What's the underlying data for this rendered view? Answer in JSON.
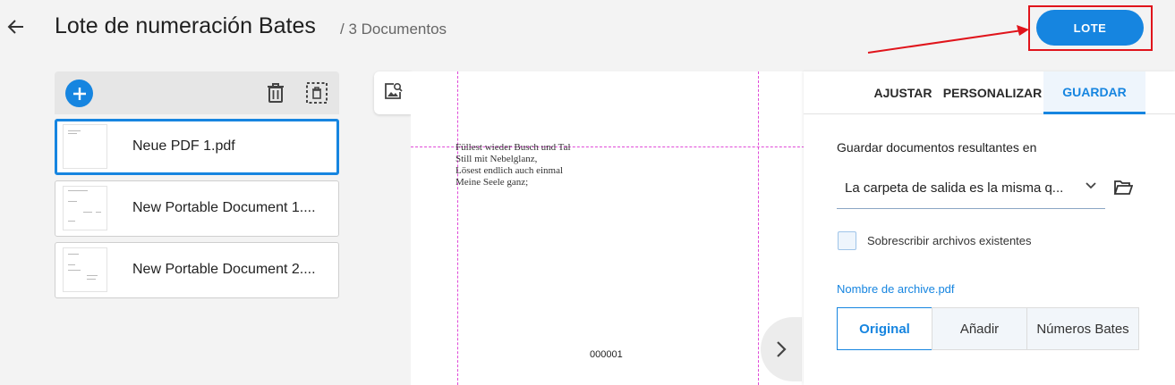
{
  "header": {
    "title": "Lote de numeración Bates",
    "doc_count": "/ 3 Documentos",
    "batch_button": "LOTE",
    "colors": {
      "accent": "#1685e0",
      "highlight": "#e0141b"
    }
  },
  "files": [
    {
      "name": "Neue PDF 1.pdf",
      "selected": true
    },
    {
      "name": "New Portable Document 1....",
      "selected": false
    },
    {
      "name": "New Portable Document 2....",
      "selected": false
    }
  ],
  "preview": {
    "text_lines": [
      "Füllest wieder Busch und Tal",
      "Still mit Nebelglanz,",
      "Lösest endlich auch einmal",
      "Meine Seele ganz;"
    ],
    "bates_number": "000001"
  },
  "settings": {
    "tabs": [
      "AJUSTAR",
      "PERSONALIZAR",
      "GUARDAR"
    ],
    "active_tab": "GUARDAR",
    "save_label": "Guardar documentos resultantes en",
    "folder_value": "La carpeta de salida es la misma q...",
    "overwrite_label": "Sobrescribir archivos existentes",
    "overwrite_checked": false,
    "filename_label": "Nombre de archive.pdf",
    "filename_options": [
      "Original",
      "Añadir",
      "Números Bates"
    ],
    "filename_selected": "Original"
  },
  "icons": {
    "back": "arrow-left-icon",
    "add": "plus-icon",
    "delete": "trash-icon",
    "select": "select-all-icon",
    "preview": "image-search-icon",
    "next": "chevron-right-icon",
    "dropdown": "chevron-down-icon",
    "browse": "folder-open-icon"
  }
}
